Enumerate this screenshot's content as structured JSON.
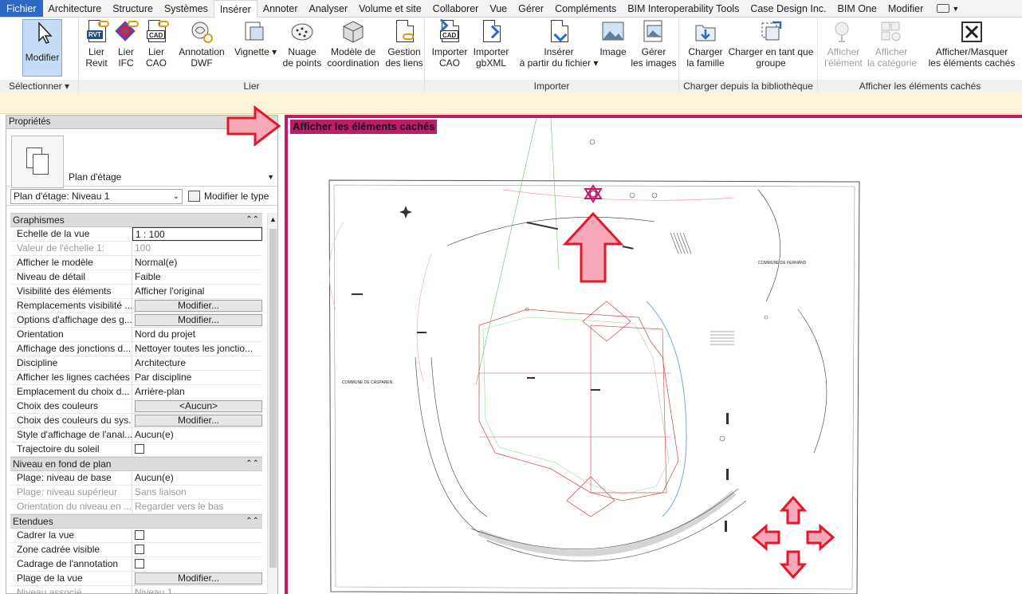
{
  "menu": {
    "items": [
      "Fichier",
      "Architecture",
      "Structure",
      "Systèmes",
      "Insérer",
      "Annoter",
      "Analyser",
      "Volume et site",
      "Collaborer",
      "Vue",
      "Gérer",
      "Compléments",
      "BIM Interoperability Tools",
      "Case Design Inc.",
      "BIM One",
      "Modifier"
    ],
    "active": "Insérer"
  },
  "ribbon": {
    "select": {
      "button": "Modifier",
      "title": "Sélectionner"
    },
    "link": {
      "title": "Lier",
      "buttons": [
        {
          "l1": "Lier",
          "l2": "Revit"
        },
        {
          "l1": "Lier",
          "l2": "IFC"
        },
        {
          "l1": "Lier",
          "l2": "CAO"
        },
        {
          "l1": "Annotation",
          "l2": "DWF"
        },
        {
          "l1": "Vignette",
          "l2": ""
        },
        {
          "l1": "Nuage",
          "l2": "de points"
        },
        {
          "l1": "Modèle de",
          "l2": "coordination"
        },
        {
          "l1": "Gestion",
          "l2": "des liens"
        }
      ]
    },
    "import": {
      "title": "Importer",
      "buttons": [
        {
          "l1": "Importer",
          "l2": "CAO"
        },
        {
          "l1": "Importer",
          "l2": "gbXML"
        },
        {
          "l1": "Insérer",
          "l2": "à partir du fichier"
        },
        {
          "l1": "Image",
          "l2": ""
        },
        {
          "l1": "Gérer",
          "l2": "les images"
        }
      ]
    },
    "library": {
      "title": "Charger depuis la bibliothèque",
      "buttons": [
        {
          "l1": "Charger",
          "l2": "la famille"
        },
        {
          "l1": "Charger en tant que",
          "l2": "groupe"
        }
      ]
    },
    "hidden": {
      "title": "Afficher les éléments cachés",
      "buttons": [
        {
          "l1": "Afficher",
          "l2": "l'élément"
        },
        {
          "l1": "Afficher",
          "l2": "la catégorie"
        },
        {
          "l1": "Afficher/Masquer",
          "l2": "les éléments cachés"
        }
      ]
    }
  },
  "properties": {
    "title": "Propriétés",
    "close": "×",
    "type_name": "Plan d'étage",
    "instance": "Plan d'étage: Niveau 1",
    "edit_type": "Modifier le type",
    "sections": [
      {
        "name": "Graphismes",
        "rows": [
          {
            "n": "Echelle de la vue",
            "v": "1 : 100",
            "kind": "edit"
          },
          {
            "n": "Valeur de l'échelle    1:",
            "v": "100",
            "kind": "dim"
          },
          {
            "n": "Afficher le modèle",
            "v": "Normal(e)"
          },
          {
            "n": "Niveau de détail",
            "v": "Faible"
          },
          {
            "n": "Visibilité des éléments",
            "v": "Afficher l'original"
          },
          {
            "n": "Remplacements visibilité ...",
            "v": "Modifier...",
            "kind": "button"
          },
          {
            "n": "Options d'affichage des g...",
            "v": "Modifier...",
            "kind": "button"
          },
          {
            "n": "Orientation",
            "v": "Nord du projet"
          },
          {
            "n": "Affichage des jonctions d...",
            "v": "Nettoyer toutes les jonctio..."
          },
          {
            "n": "Discipline",
            "v": "Architecture"
          },
          {
            "n": "Afficher les lignes cachées",
            "v": "Par discipline"
          },
          {
            "n": "Emplacement du choix d...",
            "v": "Arrière-plan"
          },
          {
            "n": "Choix des couleurs",
            "v": "<Aucun>",
            "kind": "button"
          },
          {
            "n": "Choix des couleurs du sys...",
            "v": "Modifier...",
            "kind": "button"
          },
          {
            "n": "Style d'affichage de l'anal...",
            "v": "Aucun(e)"
          },
          {
            "n": "Trajectoire du soleil",
            "v": "",
            "kind": "check"
          }
        ]
      },
      {
        "name": "Niveau en fond de plan",
        "rows": [
          {
            "n": "Plage: niveau de base",
            "v": "Aucun(e)"
          },
          {
            "n": "Plage: niveau supérieur",
            "v": "Sans liaison",
            "kind": "dim"
          },
          {
            "n": "Orientation du niveau en ...",
            "v": "Regarder vers le bas",
            "kind": "dim"
          }
        ]
      },
      {
        "name": "Etendues",
        "rows": [
          {
            "n": "Cadrer la vue",
            "v": "",
            "kind": "check"
          },
          {
            "n": "Zone cadrée visible",
            "v": "",
            "kind": "check"
          },
          {
            "n": "Cadrage de l'annotation",
            "v": "",
            "kind": "check"
          },
          {
            "n": "Plage de la vue",
            "v": "Modifier...",
            "kind": "button"
          },
          {
            "n": "Niveau associé",
            "v": "Niveau 1",
            "kind": "dim"
          }
        ]
      }
    ]
  },
  "view": {
    "banner": "Afficher les éléments cachés",
    "plan_labels": [
      "COMMUNE DE FERNAND",
      "COMMUNE DE CASPAREN"
    ]
  },
  "colors": {
    "accent": "#c11a6b",
    "ribbon_select": "#c6dcf4",
    "arrow_red": "#e0192b",
    "arrow_fill": "#f7a8b8"
  }
}
